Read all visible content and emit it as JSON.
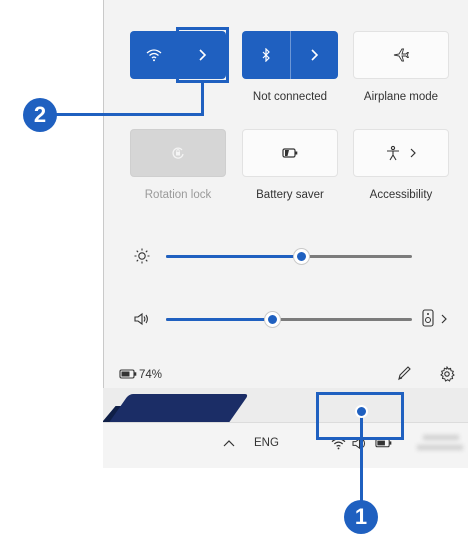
{
  "quick_settings": {
    "tiles": [
      {
        "id": "wifi",
        "label": "",
        "state": "on",
        "icon": "wifi-icon"
      },
      {
        "id": "bluetooth",
        "label": "Not connected",
        "state": "on",
        "icon": "bluetooth-icon"
      },
      {
        "id": "airplane",
        "label": "Airplane mode",
        "state": "off",
        "icon": "airplane-icon"
      },
      {
        "id": "rotation",
        "label": "Rotation lock",
        "state": "disabled",
        "icon": "rotation-lock-icon"
      },
      {
        "id": "battery_saver",
        "label": "Battery saver",
        "state": "off",
        "icon": "battery-saver-icon"
      },
      {
        "id": "accessibility",
        "label": "Accessibility",
        "state": "off",
        "icon": "accessibility-icon"
      }
    ],
    "brightness": {
      "icon": "brightness-icon",
      "value": 0.55
    },
    "volume": {
      "icon": "speaker-icon",
      "value": 0.43,
      "output_icon": "audio-output-icon"
    },
    "battery": {
      "percent": "74%",
      "icon": "battery-icon"
    },
    "footer_icons": [
      "edit-icon",
      "settings-icon"
    ]
  },
  "taskbar": {
    "language": "ENG",
    "tray_icons": [
      "chevron-up-icon",
      "wifi-icon",
      "speaker-icon",
      "battery-icon"
    ]
  },
  "callouts": [
    {
      "number": "1",
      "target": "system-tray-network-volume-battery"
    },
    {
      "number": "2",
      "target": "wifi-expand-button"
    }
  ],
  "colors": {
    "accent": "#1f60c0",
    "panel": "#f3f3f3",
    "disabled_tile": "#d6d6d6"
  }
}
